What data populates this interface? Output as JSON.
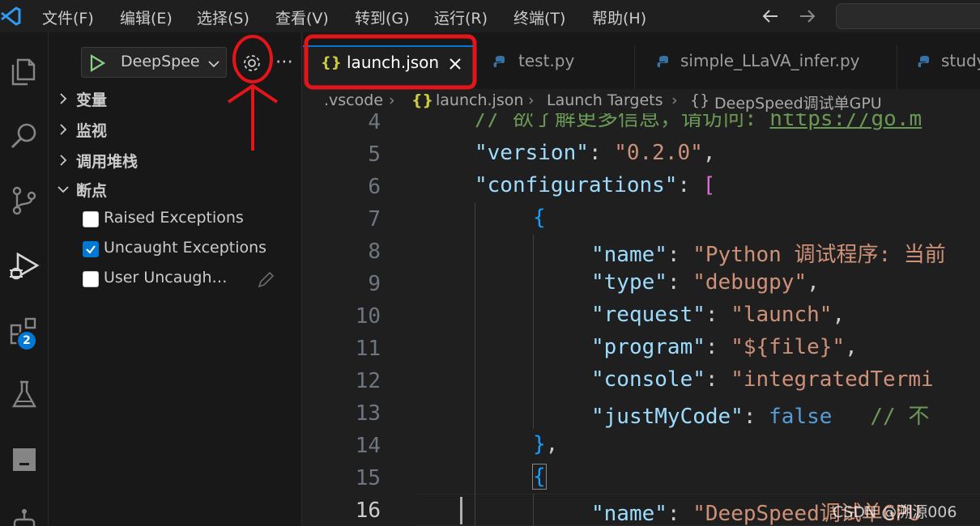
{
  "menu": {
    "items": [
      "文件(F)",
      "编辑(E)",
      "选择(S)",
      "查看(V)",
      "转到(G)",
      "运行(R)",
      "终端(T)",
      "帮助(H)"
    ]
  },
  "nav": {
    "back_icon": "arrow-left-icon",
    "forward_icon": "arrow-right-icon"
  },
  "activity_bar": {
    "icons": [
      "explorer-icon",
      "search-icon",
      "source-control-icon",
      "run-debug-icon",
      "extensions-icon",
      "testing-icon",
      "remote-icon",
      "robot-icon"
    ],
    "extensions_badge": "2"
  },
  "debug": {
    "config_name": "DeepSpee",
    "sections": {
      "variables": "变量",
      "watch": "监视",
      "call_stack": "调用堆栈",
      "breakpoints": "断点"
    },
    "breakpoints": [
      {
        "label": "Raised Exceptions",
        "checked": false
      },
      {
        "label": "Uncaught Exceptions",
        "checked": true
      },
      {
        "label": "User Uncaugh…",
        "checked": false
      }
    ]
  },
  "tabs": [
    {
      "icon": "{}",
      "label": "launch.json",
      "active": true
    },
    {
      "icon": "python-icon",
      "label": "test.py",
      "active": false
    },
    {
      "icon": "python-icon",
      "label": "simple_LLaVA_infer.py",
      "active": false
    },
    {
      "icon": "python-icon",
      "label": "study",
      "active": false
    }
  ],
  "breadcrumb": {
    "folder": ".vscode",
    "file_icon": "{}",
    "file": "launch.json",
    "section": "Launch Targets",
    "item_icon": "{}",
    "item": "DeepSpeed调试单GPU"
  },
  "editor": {
    "line_numbers": [
      "4",
      "5",
      "6",
      "7",
      "8",
      "9",
      "10",
      "11",
      "12",
      "13",
      "14",
      "15",
      "16"
    ],
    "current_line": "16",
    "l4_comment": "// 欲了解更多信息，请访问: ",
    "l4_url": "https://go.m",
    "l5_key": "\"version\"",
    "l5_val": "\"0.2.0\"",
    "l6_key": "\"configurations\"",
    "l8_key": "\"name\"",
    "l8_val": "\"Python 调试程序: 当前",
    "l9_key": "\"type\"",
    "l9_val": "\"debugpy\"",
    "l10_key": "\"request\"",
    "l10_val": "\"launch\"",
    "l11_key": "\"program\"",
    "l11_val": "\"${file}\"",
    "l12_key": "\"console\"",
    "l12_val": "\"integratedTermi",
    "l13_key": "\"justMyCode\"",
    "l13_val": "false",
    "l13_comment": "// 不",
    "l16_key": "\"name\"",
    "l16_val": "\"DeepSpeed调试单GPU"
  },
  "watermark": "CSDN @溯源006",
  "colors": {
    "annotation_red": "#e4141b",
    "accent": "#0078d4"
  }
}
